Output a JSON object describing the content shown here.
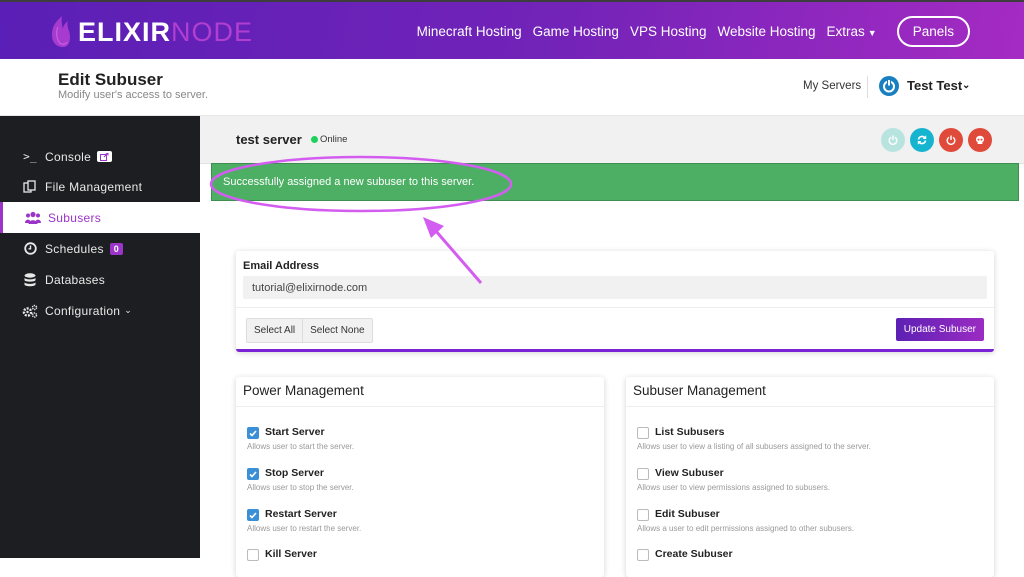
{
  "brand": {
    "part1": "ELIXIR",
    "part2": "NODE"
  },
  "nav": {
    "links": [
      "Minecraft Hosting",
      "Game Hosting",
      "VPS Hosting",
      "Website Hosting",
      "Extras"
    ],
    "panels_label": "Panels"
  },
  "header": {
    "title": "Edit Subuser",
    "subtitle": "Modify user's access to server.",
    "my_servers": "My Servers",
    "user_name": "Test Test"
  },
  "sidebar": {
    "items": [
      {
        "label": "Console",
        "icon": "terminal-icon"
      },
      {
        "label": "File Management",
        "icon": "files-icon"
      },
      {
        "label": "Subusers",
        "icon": "users-icon",
        "active": true
      },
      {
        "label": "Schedules",
        "icon": "clock-icon",
        "badge": "0"
      },
      {
        "label": "Databases",
        "icon": "database-icon"
      },
      {
        "label": "Configuration",
        "icon": "gears-icon"
      }
    ]
  },
  "server": {
    "name": "test server",
    "status": "Online",
    "status_color": "#1dd15a"
  },
  "alert": {
    "message": "Successfully assigned a new subuser to this server."
  },
  "form": {
    "email_label": "Email Address",
    "email_value": "tutorial@elixirnode.com",
    "select_all": "Select All",
    "select_none": "Select None",
    "update_label": "Update Subuser"
  },
  "power_management": {
    "title": "Power Management",
    "permissions": [
      {
        "name": "Start Server",
        "desc": "Allows user to start the server.",
        "checked": true
      },
      {
        "name": "Stop Server",
        "desc": "Allows user to stop the server.",
        "checked": true
      },
      {
        "name": "Restart Server",
        "desc": "Allows user to restart the server.",
        "checked": true
      },
      {
        "name": "Kill Server",
        "desc": "",
        "checked": false
      }
    ]
  },
  "subuser_management": {
    "title": "Subuser Management",
    "permissions": [
      {
        "name": "List Subusers",
        "desc": "Allows user to view a listing of all subusers assigned to the server.",
        "checked": false
      },
      {
        "name": "View Subuser",
        "desc": "Allows user to view permissions assigned to subusers.",
        "checked": false
      },
      {
        "name": "Edit Subuser",
        "desc": "Allows a user to edit permissions assigned to other subusers.",
        "checked": false
      },
      {
        "name": "Create Subuser",
        "desc": "",
        "checked": false
      }
    ]
  },
  "colors": {
    "accent": "#9b34c9",
    "alert_success": "#4caf64",
    "checkbox": "#3a8fd6"
  }
}
